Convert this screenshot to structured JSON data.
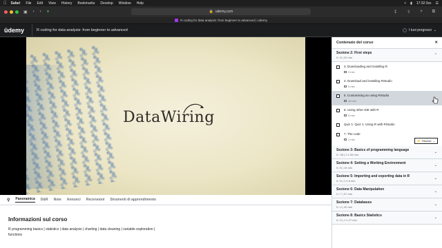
{
  "menubar": {
    "app": "Safari",
    "items": [
      "File",
      "Edit",
      "View",
      "History",
      "Bookmarks",
      "Develop",
      "Window",
      "Help"
    ],
    "clock": "17:32:3xx"
  },
  "browser": {
    "url": "udemy.com",
    "tab_title": "R coding for data analysis: from beginner to advanced | Udemy"
  },
  "header": {
    "logo": "ûdemy",
    "course_title": "R coding for data analysis: from beginner to advanced",
    "progress_label": "I tuoi progressi"
  },
  "video": {
    "brand": "DataWiring"
  },
  "subtabs": [
    "Panoramica",
    "D&R",
    "Note",
    "Annunci",
    "Recensioni",
    "Strumenti di apprendimento"
  ],
  "info": {
    "title": "Informazioni sul corso",
    "description": "R programming basics | statistics | data analysis | charting | data cleaning | variable exploration | functions"
  },
  "sidebar": {
    "title": "Contenuto del corso",
    "open_section": {
      "title": "Sezione 2: First steps",
      "meta": "0 / 8 | 25 min",
      "lectures": [
        {
          "title": "3. Downloading and installing R",
          "duration": "3 min",
          "active": false
        },
        {
          "title": "4. Download and installing RStudio",
          "duration": "3 min",
          "active": false
        },
        {
          "title": "5. Customising an using RStudio",
          "duration": "10 min",
          "active": true
        },
        {
          "title": "6. Using other IDE with R",
          "duration": "5 min",
          "active": false
        },
        {
          "title": "Quiz 1: Quiz 1: Using R with RStudio",
          "duration": "",
          "active": false
        },
        {
          "title": "7. The code",
          "duration": "1 min",
          "active": false,
          "resources": "Risorse"
        }
      ]
    },
    "sections": [
      {
        "title": "Sezione 3: Basics of programming language",
        "meta": "0 / 38 | 2 h 38 min"
      },
      {
        "title": "Sezione 4: Setting a Working Environment",
        "meta": "0 / 8 | 15 min"
      },
      {
        "title": "Sezione 5: Importing and exporting data in R",
        "meta": "0 / 8 | 1 h 5 min"
      },
      {
        "title": "Sezione 6: Data Manipulation",
        "meta": "0 / 7 | 57 min"
      },
      {
        "title": "Sezione 7: Databases",
        "meta": "0 / 4 | 40 min"
      },
      {
        "title": "Sezione 8: Basics Statistics",
        "meta": "0 / 5 | 1 h 27 min"
      }
    ]
  }
}
